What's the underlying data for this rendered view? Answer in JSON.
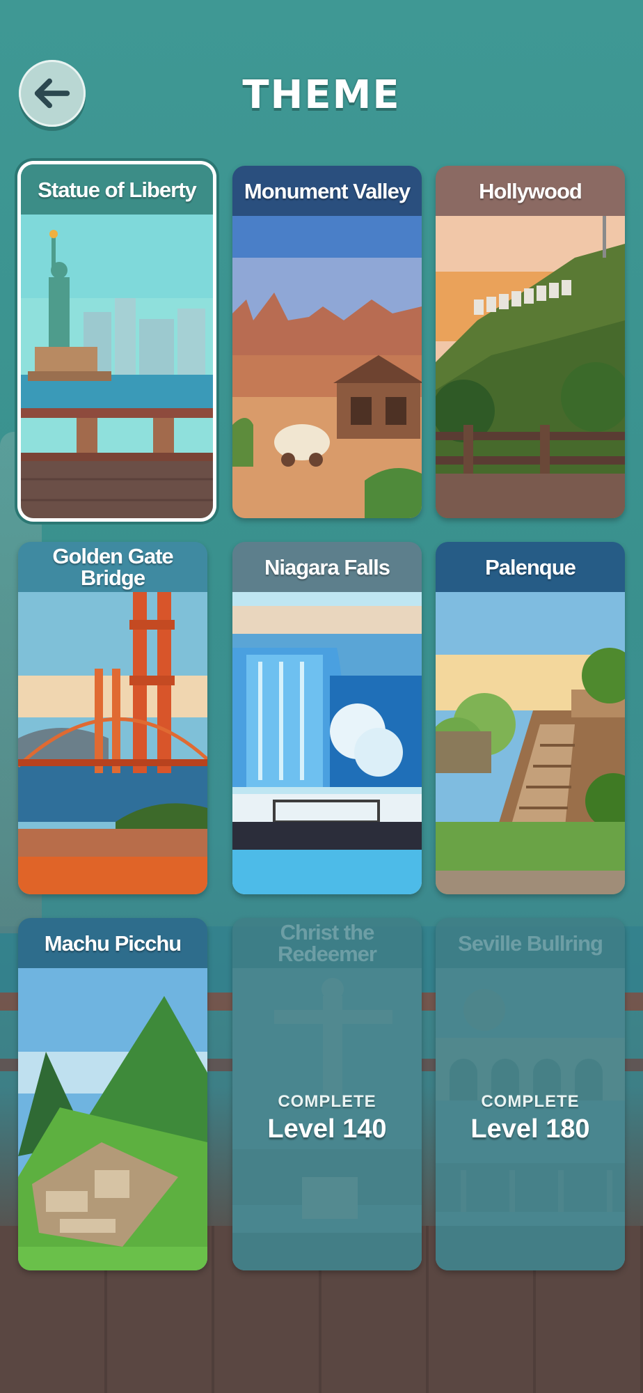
{
  "header": {
    "title": "THEME",
    "back_icon": "arrow-left-icon"
  },
  "themes": [
    {
      "name": "Statue of Liberty",
      "selected": true,
      "locked": false,
      "label_color": "#3c8d87"
    },
    {
      "name": "Monument Valley",
      "selected": false,
      "locked": false,
      "label_color": "#2a4f7e"
    },
    {
      "name": "Hollywood",
      "selected": false,
      "locked": false,
      "label_color": "#8b6a63"
    },
    {
      "name": "Golden Gate Bridge",
      "selected": false,
      "locked": false,
      "label_color": "#3f8aa1"
    },
    {
      "name": "Niagara Falls",
      "selected": false,
      "locked": false,
      "label_color": "#5d7f8c"
    },
    {
      "name": "Palenque",
      "selected": false,
      "locked": false,
      "label_color": "#265c86"
    },
    {
      "name": "Machu Picchu",
      "selected": false,
      "locked": false,
      "label_color": "#2e6d8c"
    },
    {
      "name": "Christ the Redeemer",
      "selected": false,
      "locked": true,
      "unlock_prefix": "COMPLETE",
      "unlock_level": "Level 140"
    },
    {
      "name": "Seville Bullring",
      "selected": false,
      "locked": true,
      "unlock_prefix": "COMPLETE",
      "unlock_level": "Level 180"
    }
  ]
}
